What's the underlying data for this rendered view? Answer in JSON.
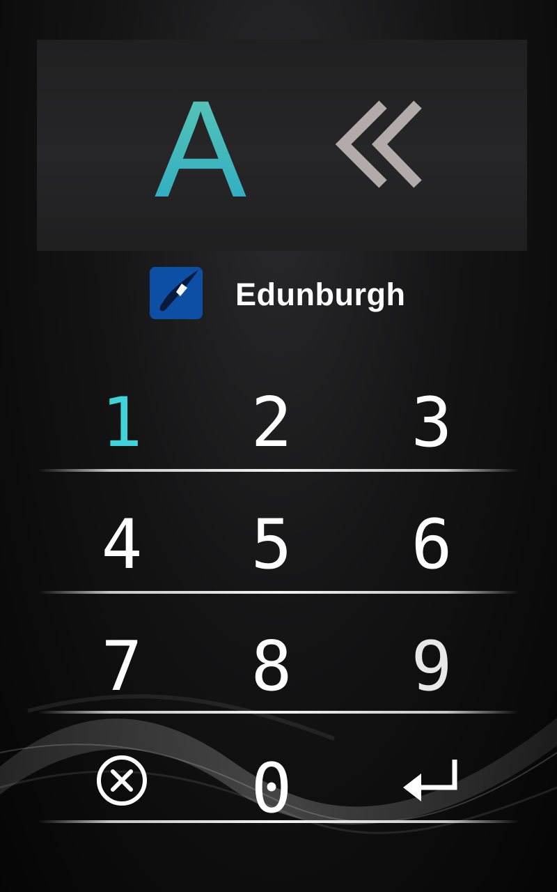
{
  "display": {
    "floor_label": "A",
    "floor_color": "#3dbdbd",
    "back_icon": "double-chevron-left-icon",
    "back_icon_color": "#b3aaaa"
  },
  "brand": {
    "name": "Edunburgh",
    "logo_icon": "brand-logo-icon",
    "logo_color": "#0e4fa6"
  },
  "keypad": {
    "keys": [
      "1",
      "2",
      "3",
      "4",
      "5",
      "6",
      "7",
      "8",
      "9",
      "0"
    ],
    "cancel_icon": "cancel-circle-x-icon",
    "enter_icon": "enter-return-icon",
    "highlight_key": "1",
    "highlight_color": "#3fd4dc",
    "default_color": "#ffffff"
  }
}
